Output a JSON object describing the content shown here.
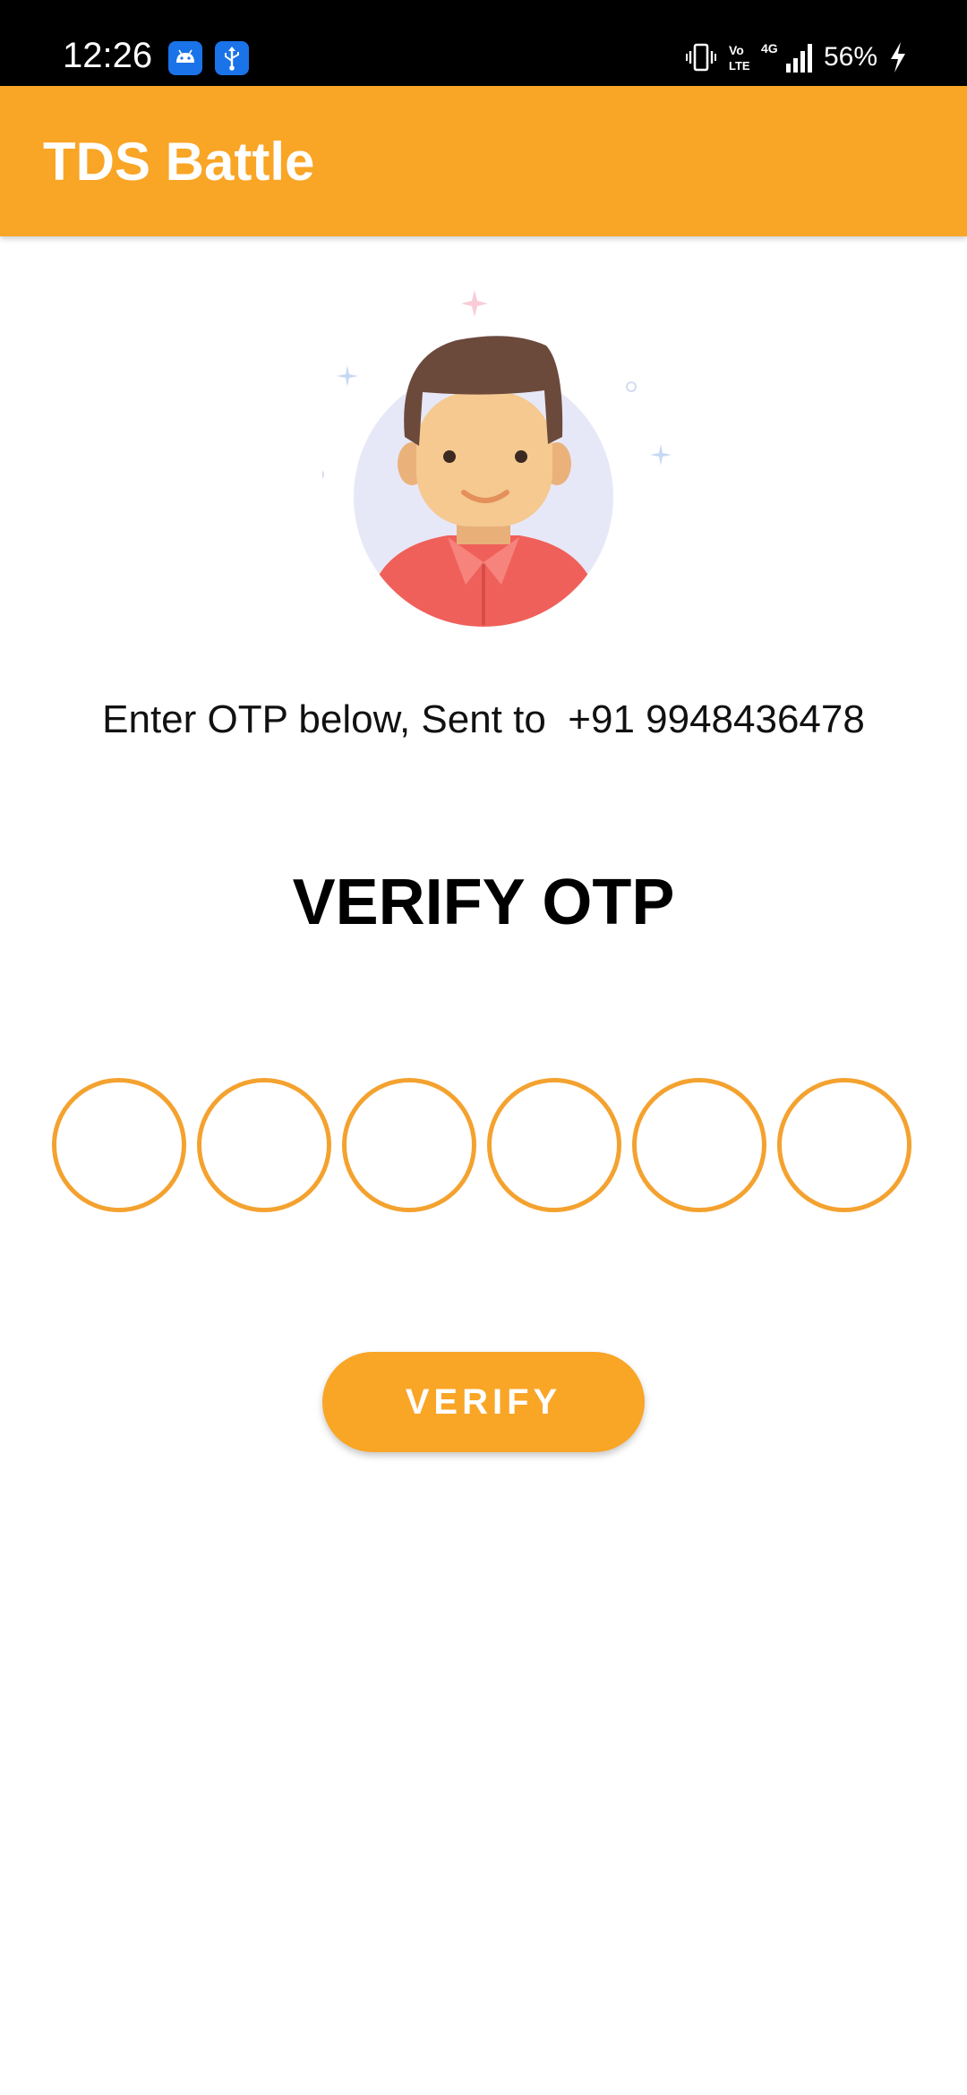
{
  "status_bar": {
    "time": "12:26",
    "icons": [
      "android-notification-icon",
      "usb-notification-icon"
    ],
    "right_icons": [
      "vibrate-icon",
      "volte-icon",
      "4g-signal-icon",
      "battery-charging-icon"
    ],
    "volte_label": "Vo\nLTE",
    "network_label": "4G",
    "battery": "56%"
  },
  "app_bar": {
    "title": "TDS Battle",
    "color": "#f9a526"
  },
  "otp": {
    "instruction": "Enter OTP below, Sent to  +91 9948436478",
    "heading": "VERIFY OTP",
    "boxes": [
      "",
      "",
      "",
      "",
      "",
      ""
    ],
    "border_color": "#f4a22f"
  },
  "actions": {
    "verify_label": "VERIFY"
  }
}
